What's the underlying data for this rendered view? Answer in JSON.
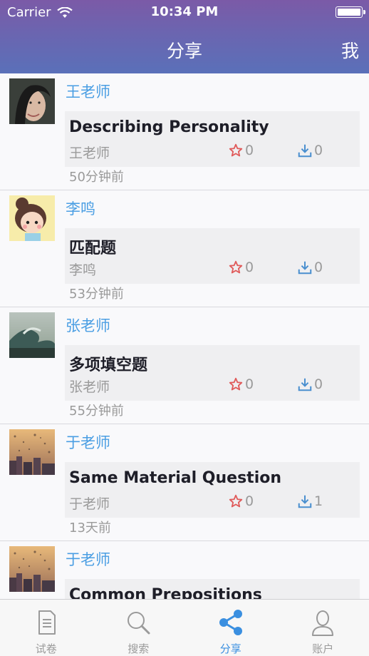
{
  "status_bar": {
    "carrier": "Carrier",
    "time": "10:34 PM"
  },
  "nav": {
    "title": "分享",
    "right": "我"
  },
  "feed": [
    {
      "author": "王老师",
      "title": "Describing Personality",
      "owner": "王老师",
      "stars": "0",
      "downloads": "0",
      "time_ago": "50分钟前",
      "avatar": "woman-portrait"
    },
    {
      "author": "李鸣",
      "title": "匹配题",
      "owner": "李鸣",
      "stars": "0",
      "downloads": "0",
      "time_ago": "53分钟前",
      "avatar": "cartoon-girl"
    },
    {
      "author": "张老师",
      "title": "多项填空题",
      "owner": "张老师",
      "stars": "0",
      "downloads": "0",
      "time_ago": "55分钟前",
      "avatar": "ocean-wave"
    },
    {
      "author": "于老师",
      "title": "Same Material Question",
      "owner": "于老师",
      "stars": "0",
      "downloads": "1",
      "time_ago": "13天前",
      "avatar": "rainy-city"
    },
    {
      "author": "于老师",
      "title": "Common Prepositions",
      "owner": "",
      "stars": "",
      "downloads": "",
      "time_ago": "",
      "avatar": "rainy-city"
    }
  ],
  "tabs": [
    {
      "label": "试卷",
      "icon": "document-icon",
      "active": false
    },
    {
      "label": "搜索",
      "icon": "search-icon",
      "active": false
    },
    {
      "label": "分享",
      "icon": "share-icon",
      "active": true
    },
    {
      "label": "账户",
      "icon": "account-icon",
      "active": false
    }
  ],
  "colors": {
    "accent": "#3a8fe0",
    "author_blue": "#4a9ee3",
    "star_red": "#e05a5a",
    "download_blue": "#4a8fcf",
    "header_top": "#7b5aa7",
    "header_bottom": "#5a70b9"
  }
}
